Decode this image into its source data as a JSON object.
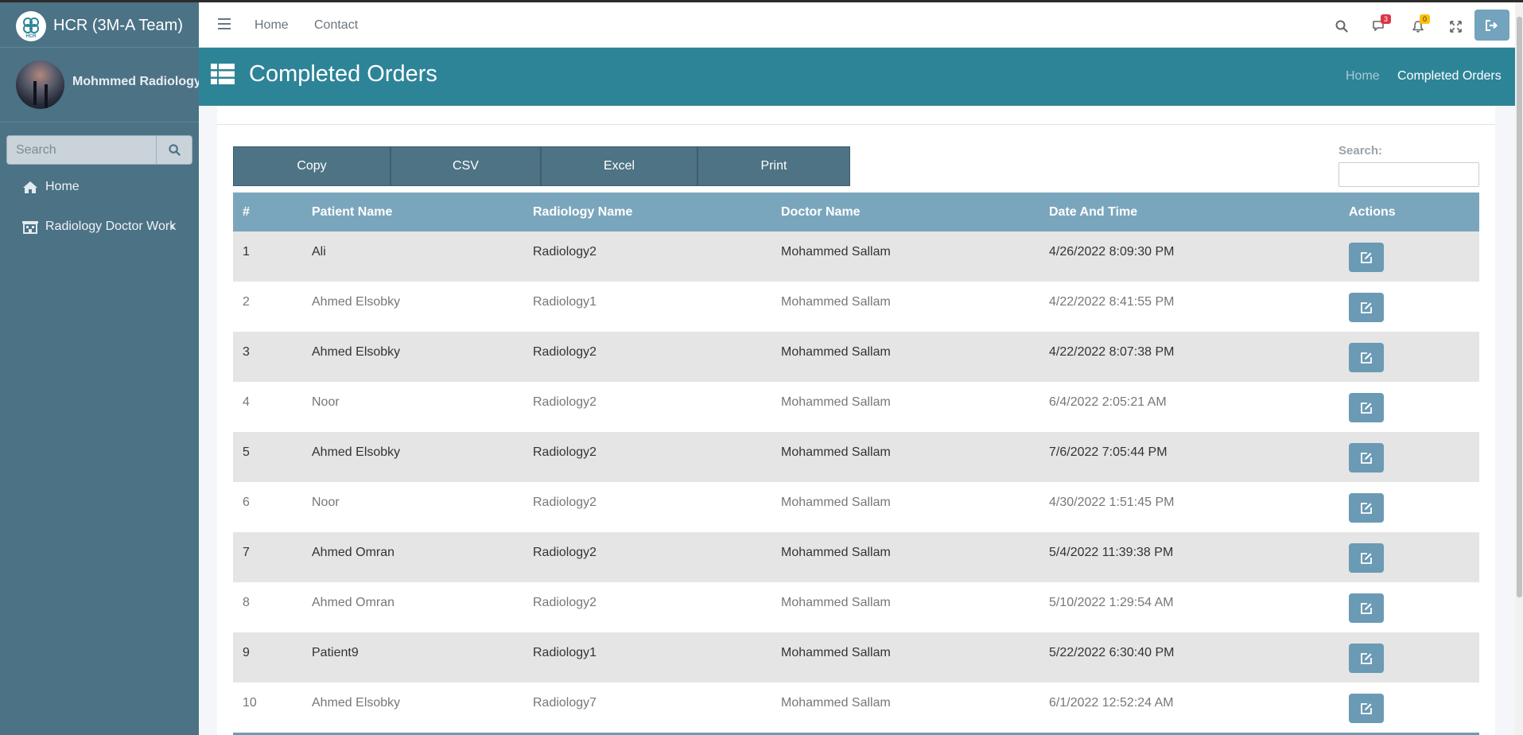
{
  "app": {
    "title": "HCR (3M-A Team)",
    "logo_text": "HCR",
    "user_name": "Mohmmed Radiology"
  },
  "sidebar": {
    "search_placeholder": "Search",
    "items": [
      {
        "label": "Home",
        "icon": "home-icon"
      },
      {
        "label": "Radiology Doctor Work",
        "icon": "hospital-icon",
        "chevron": "‹"
      }
    ]
  },
  "navbar": {
    "links": [
      "Home",
      "Contact"
    ],
    "messages_count": "3",
    "notifications_count": "0"
  },
  "header": {
    "title": "Completed Orders",
    "breadcrumb": [
      "Home",
      "Completed Orders"
    ]
  },
  "toolbar": {
    "buttons": [
      "Copy",
      "CSV",
      "Excel",
      "Print"
    ],
    "search_label": "Search:",
    "search_value": ""
  },
  "table": {
    "columns": [
      "#",
      "Patient Name",
      "Radiology Name",
      "Doctor Name",
      "Date And Time",
      "Actions"
    ],
    "rows": [
      [
        "1",
        "Ali",
        "Radiology2",
        "Mohammed Sallam",
        "4/26/2022 8:09:30 PM"
      ],
      [
        "2",
        "Ahmed Elsobky",
        "Radiology1",
        "Mohammed Sallam",
        "4/22/2022 8:41:55 PM"
      ],
      [
        "3",
        "Ahmed Elsobky",
        "Radiology2",
        "Mohammed Sallam",
        "4/22/2022 8:07:38 PM"
      ],
      [
        "4",
        "Noor",
        "Radiology2",
        "Mohammed Sallam",
        "6/4/2022 2:05:21 AM"
      ],
      [
        "5",
        "Ahmed Elsobky",
        "Radiology2",
        "Mohammed Sallam",
        "7/6/2022 7:05:44 PM"
      ],
      [
        "6",
        "Noor",
        "Radiology2",
        "Mohammed Sallam",
        "4/30/2022 1:51:45 PM"
      ],
      [
        "7",
        "Ahmed Omran",
        "Radiology2",
        "Mohammed Sallam",
        "5/4/2022 11:39:38 PM"
      ],
      [
        "8",
        "Ahmed Omran",
        "Radiology2",
        "Mohammed Sallam",
        "5/10/2022 1:29:54 AM"
      ],
      [
        "9",
        "Patient9",
        "Radiology1",
        "Mohammed Sallam",
        "5/22/2022 6:30:40 PM"
      ],
      [
        "10",
        "Ahmed Elsobky",
        "Radiology7",
        "Mohammed Sallam",
        "6/1/2022 12:52:24 AM"
      ]
    ]
  },
  "colors": {
    "sidebar": "#4b7285",
    "header": "#2e8497",
    "table_header": "#7aa6bd",
    "export_button": "#4e7385",
    "action_button": "#6b9ab5",
    "badge_messages": "#dc3545",
    "badge_notifications": "#ffc107"
  }
}
